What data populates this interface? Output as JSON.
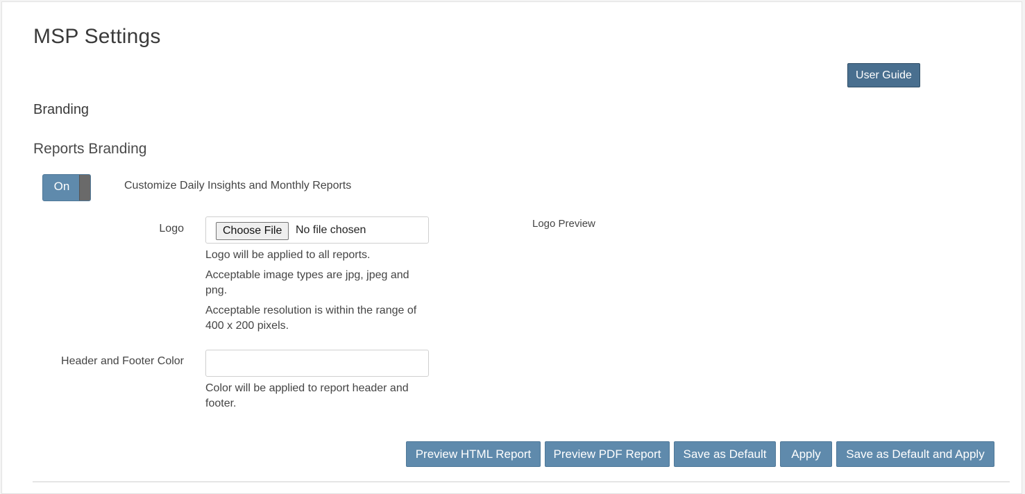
{
  "page": {
    "title": "MSP Settings",
    "user_guide_label": "User Guide"
  },
  "branding": {
    "section_title": "Branding",
    "reports_branding_title": "Reports Branding",
    "toggle": {
      "state_label": "On",
      "description": "Customize Daily Insights and Monthly Reports"
    },
    "logo": {
      "label": "Logo",
      "choose_file_label": "Choose File",
      "file_status": "No file chosen",
      "help_lines": [
        "Logo will be applied to all reports.",
        "Acceptable image types are jpg, jpeg and png.",
        "Acceptable resolution is within the range of 400 x 200 pixels."
      ],
      "preview_label": "Logo Preview"
    },
    "header_footer_color": {
      "label": "Header and Footer Color",
      "value": "",
      "help": "Color will be applied to report header and footer."
    }
  },
  "actions": {
    "preview_html": "Preview HTML Report",
    "preview_pdf": "Preview PDF Report",
    "save_default": "Save as Default",
    "apply": "Apply",
    "save_default_apply": "Save as Default and Apply"
  },
  "colors": {
    "primary_button": "#5f8aac",
    "user_guide_button": "#496f8f",
    "toggle_knob": "#6a6a6a"
  }
}
